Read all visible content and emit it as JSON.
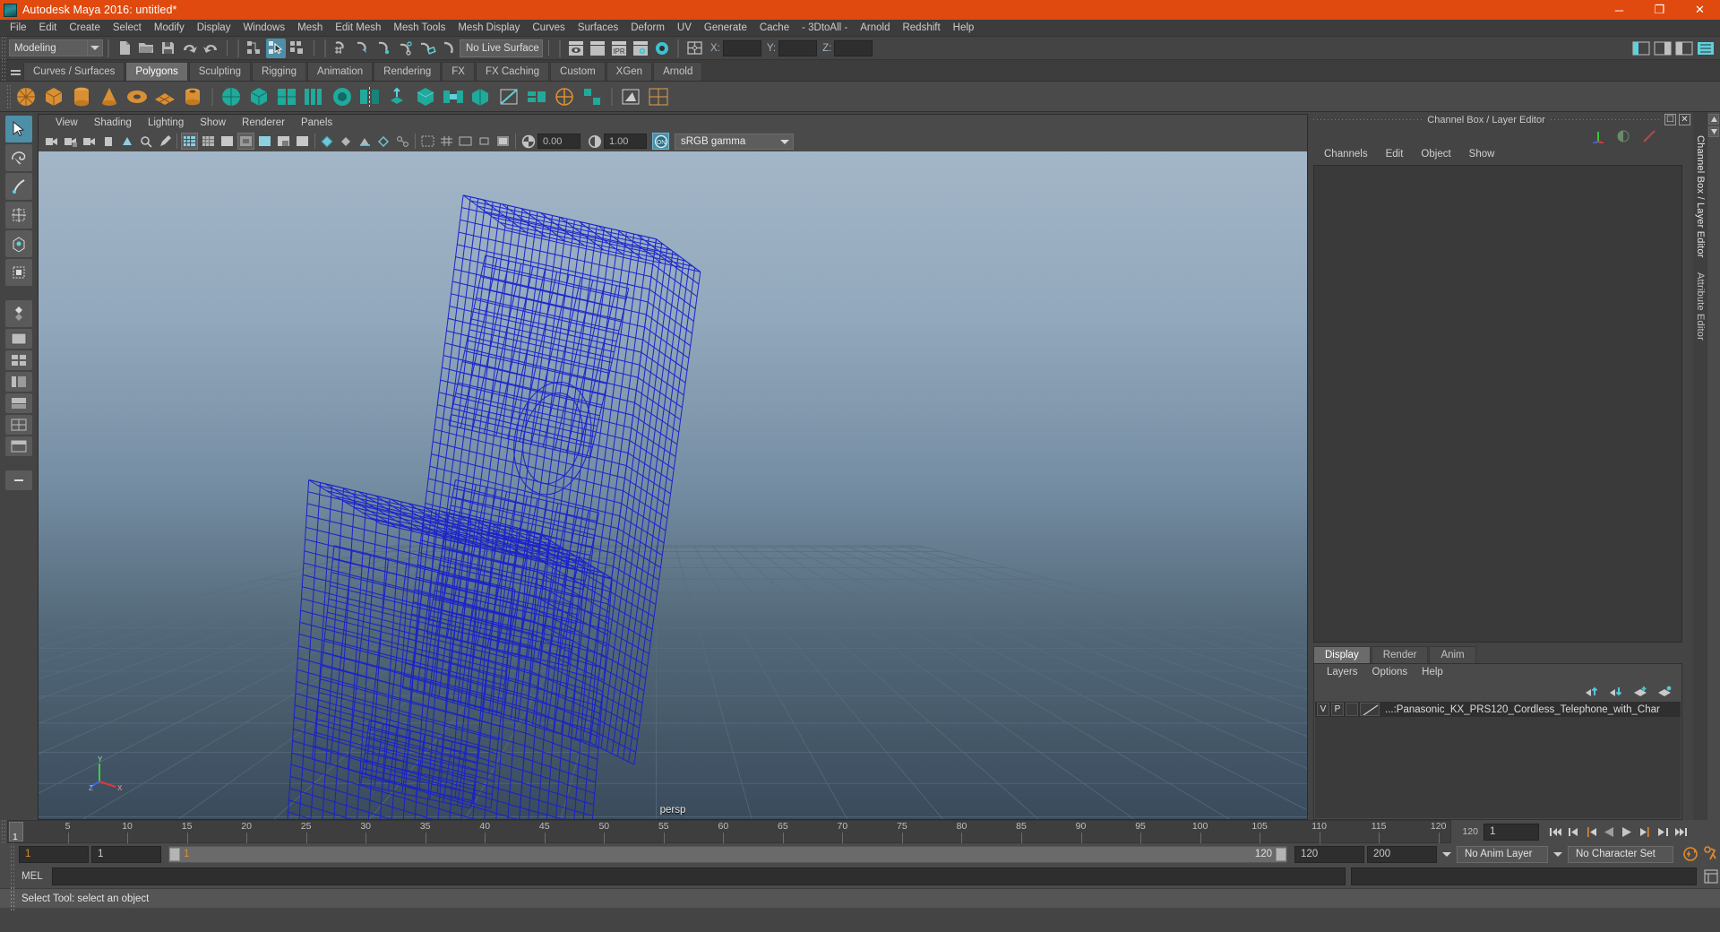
{
  "window": {
    "title": "Autodesk Maya 2016: untitled*",
    "accent_color": "#e04a0e",
    "minimize": "─",
    "maximize": "❐",
    "close": "✕"
  },
  "menubar": {
    "items": [
      "File",
      "Edit",
      "Create",
      "Select",
      "Modify",
      "Display",
      "Windows",
      "Mesh",
      "Edit Mesh",
      "Mesh Tools",
      "Mesh Display",
      "Curves",
      "Surfaces",
      "Deform",
      "UV",
      "Generate",
      "Cache",
      "- 3DtoAll -",
      "Arnold",
      "Redshift",
      "Help"
    ]
  },
  "statusbar": {
    "mode_menu": "Modeling",
    "live_surface": "No Live Surface",
    "coord_labels": {
      "x": "X:",
      "y": "Y:",
      "z": "Z:"
    },
    "coord_values": {
      "x": "",
      "y": "",
      "z": ""
    }
  },
  "shelf": {
    "tabs": [
      "Curves / Surfaces",
      "Polygons",
      "Sculpting",
      "Rigging",
      "Animation",
      "Rendering",
      "FX",
      "FX Caching",
      "Custom",
      "XGen",
      "Arnold"
    ],
    "active_tab": "Polygons"
  },
  "viewport": {
    "menus": [
      "View",
      "Shading",
      "Lighting",
      "Show",
      "Renderer",
      "Panels"
    ],
    "exposure": "0.00",
    "gamma": "1.00",
    "color_profile": "sRGB gamma",
    "camera_label": "persp",
    "axis_labels": {
      "y": "Y",
      "z": "Z",
      "x": "X"
    }
  },
  "channelbox": {
    "panel_title": "Channel Box / Layer Editor",
    "menus": [
      "Channels",
      "Edit",
      "Object",
      "Show"
    ],
    "layer_tabs": [
      "Display",
      "Render",
      "Anim"
    ],
    "active_layer_tab": "Display",
    "layer_menus": [
      "Layers",
      "Options",
      "Help"
    ],
    "layers": [
      {
        "visibility": "V",
        "playback": "P",
        "type": "",
        "name": "...:Panasonic_KX_PRS120_Cordless_Telephone_with_Char"
      }
    ]
  },
  "right_vtabs": [
    "Channel Box / Layer Editor",
    "Attribute Editor"
  ],
  "timeline": {
    "ticks": [
      5,
      10,
      15,
      20,
      25,
      30,
      35,
      40,
      45,
      50,
      55,
      60,
      65,
      70,
      75,
      80,
      85,
      90,
      95,
      100,
      105,
      110,
      115,
      120
    ],
    "current_frame": "1",
    "end_label": "120",
    "frame_field": "1",
    "playback_buttons": [
      "go-to-start",
      "step-back-key",
      "step-back-frame",
      "play-backwards",
      "play-forwards",
      "step-forward-frame",
      "step-forward-key",
      "go-to-end"
    ]
  },
  "range": {
    "start": "1",
    "start2": "1",
    "range_start": "1",
    "range_end": "120",
    "end": "120",
    "end2": "200",
    "anim_layer": "No Anim Layer",
    "character_set": "No Character Set"
  },
  "command": {
    "label": "MEL",
    "value": "",
    "placeholder": ""
  },
  "help": {
    "text": "Select Tool: select an object"
  }
}
